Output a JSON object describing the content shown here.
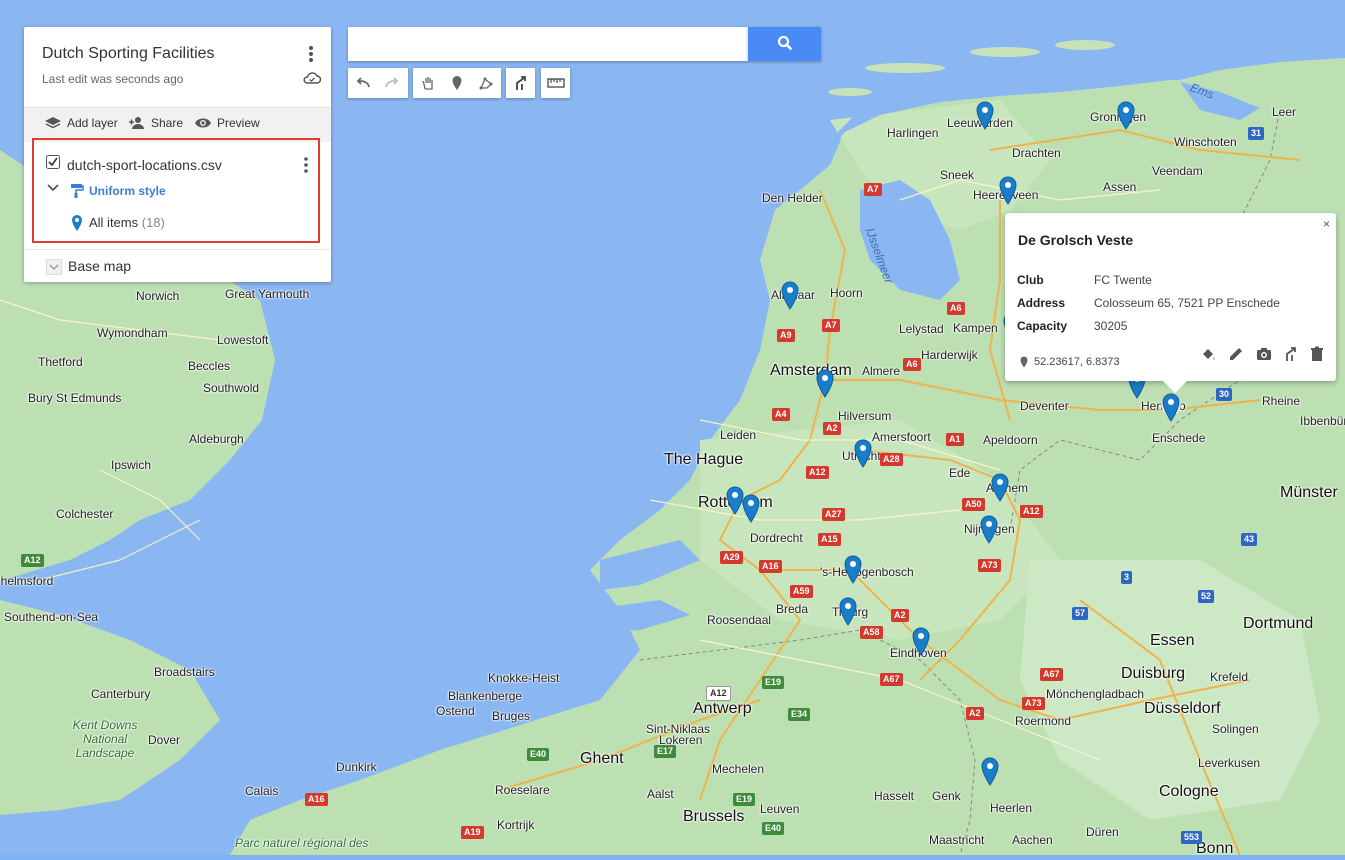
{
  "panel": {
    "title": "Dutch Sporting Facilities",
    "subtitle": "Last edit was seconds ago",
    "toolbar": {
      "add_layer": "Add layer",
      "share": "Share",
      "preview": "Preview"
    },
    "layer": {
      "name": "dutch-sport-locations.csv",
      "checked": true,
      "style_label": "Uniform style",
      "items_label": "All items",
      "items_count": "(18)"
    },
    "base_map": "Base map"
  },
  "search": {
    "value": "",
    "placeholder": ""
  },
  "popup": {
    "title": "De Grolsch Veste",
    "fields": [
      {
        "key": "Club",
        "value": "FC Twente"
      },
      {
        "key": "Address",
        "value": "Colosseum 65, 7521 PP Enschede"
      },
      {
        "key": "Capacity",
        "value": "30205"
      }
    ],
    "coords": "52.23617, 6.8373",
    "close": "×"
  },
  "map": {
    "cities_big": [
      "Amsterdam",
      "The Hague",
      "Antwerp",
      "Ghent",
      "Brussels",
      "Essen",
      "Duisburg",
      "Dortmund",
      "Düsseldorf",
      "Cologne",
      "Münster",
      "Bonn"
    ],
    "cities": [
      "Harlingen",
      "Leeuwarden",
      "Groningen",
      "Drachten",
      "Winschoten",
      "Veendam",
      "Assen",
      "Sneek",
      "Heerenveen",
      "Den Helder",
      "Alkmaar",
      "Hoorn",
      "Lelystad",
      "Kampen",
      "Harderwijk",
      "Almere",
      "Hilversum",
      "Leiden",
      "Utrecht",
      "Amersfoort",
      "Apeldoorn",
      "Deventer",
      "Hengelo",
      "Enschede",
      "Rheine",
      "Ibbenbüren",
      "Ede",
      "Arnhem",
      "Nijmegen",
      "Rotterdam",
      "Dordrecht",
      "'s-Hertogenbosch",
      "Breda",
      "Roosendaal",
      "Tilburg",
      "Eindhoven",
      "Knokke-Heist",
      "Blankenberge",
      "Ostend",
      "Bruges",
      "Sint-Niklaas",
      "Lokeren",
      "Mechelen",
      "Roeselare",
      "Aalst",
      "Kortrijk",
      "Leuven",
      "Hasselt",
      "Genk",
      "Heerlen",
      "Maastricht",
      "Aachen",
      "Düren",
      "Roermond",
      "Mönchengladbach",
      "Krefeld",
      "Solingen",
      "Leverkusen",
      "Dunkirk",
      "Calais",
      "Norwich",
      "Great Yarmouth",
      "Lowestoft",
      "Wymondham",
      "Thetford",
      "Beccles",
      "Southwold",
      "Bury St Edmunds",
      "Aldeburgh",
      "Ipswich",
      "Colchester",
      "Chelmsford",
      "Southend-on-Sea",
      "Broadstairs",
      "Canterbury",
      "Dover",
      "Leer"
    ],
    "water_labels": [
      "IJsselmeer",
      "Ems"
    ],
    "park_labels": [
      "Kent Downs National Landscape",
      "Parc naturel régional des"
    ],
    "pin_count": 18
  }
}
